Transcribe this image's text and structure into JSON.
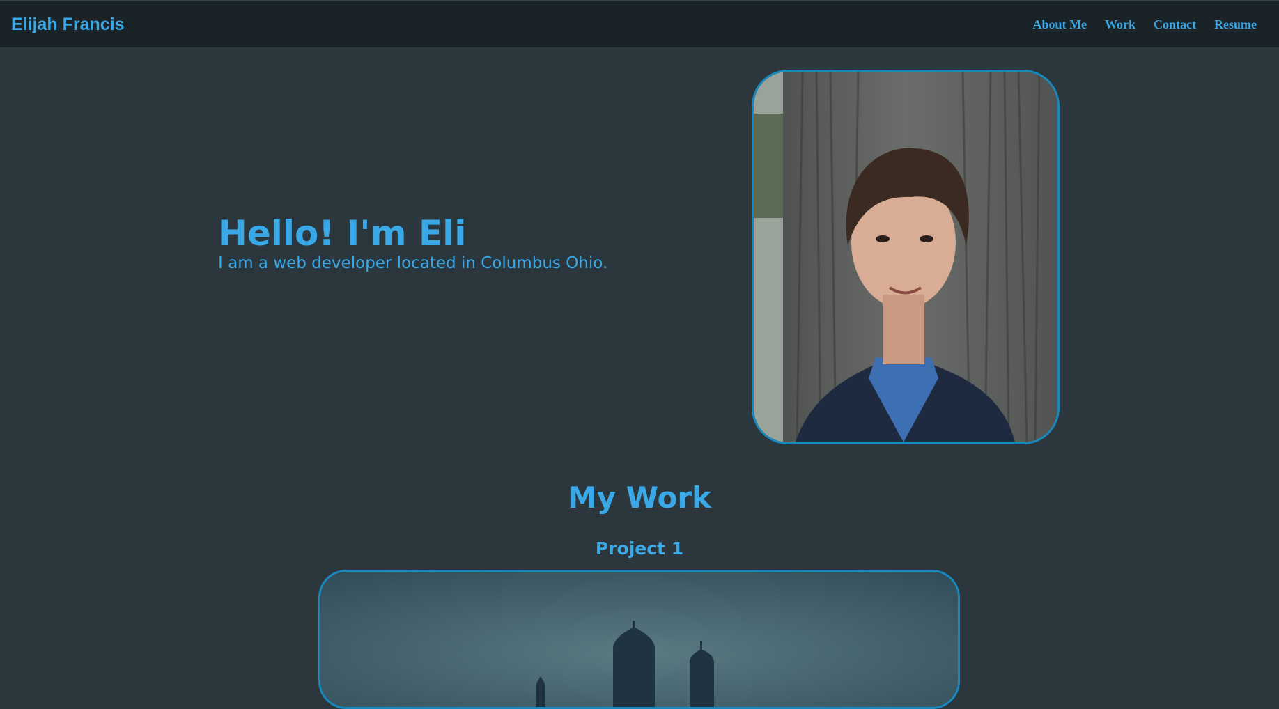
{
  "header": {
    "brand": "Elijah Francis",
    "nav": [
      {
        "label": "About Me"
      },
      {
        "label": "Work"
      },
      {
        "label": "Contact"
      },
      {
        "label": "Resume"
      }
    ]
  },
  "hero": {
    "title": "Hello! I'm Eli",
    "subtitle": "I am a web developer located in Columbus Ohio."
  },
  "work": {
    "title": "My Work",
    "projects": [
      {
        "title": "Project 1"
      }
    ]
  },
  "colors": {
    "accent": "#3aa8e6",
    "border": "#1789bf",
    "page_bg": "#2c373d",
    "header_bg": "#1a2328"
  }
}
